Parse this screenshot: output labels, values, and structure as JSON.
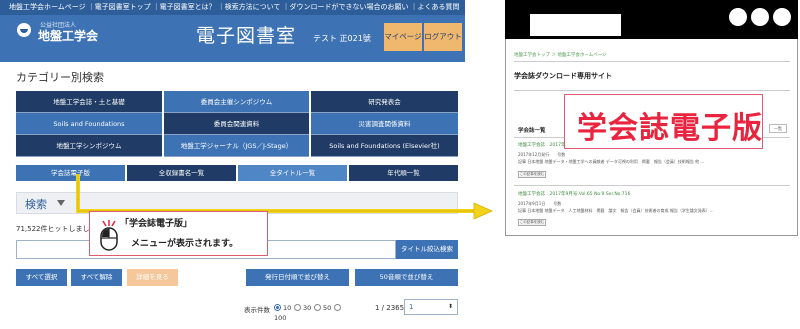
{
  "topbar": {
    "links": [
      "地盤工学会ホームページ",
      "｜電子図書室トップ",
      "｜電子図書室とは？",
      "｜検索方法について",
      "｜ダウンロードができない場合のお願い",
      "｜よくある質問"
    ]
  },
  "header": {
    "logo_sub": "公益社団法人",
    "logo_main": "地盤工学会",
    "title": "電子図書室",
    "user": "テスト 正021號",
    "mypage_label": "マイページ",
    "logout_label": "ログアウト"
  },
  "category": {
    "title": "カテゴリー別検索",
    "items": [
      "地盤工学会誌・土と基礎",
      "委員会主催シンポジウム",
      "研究発表会",
      "Soils and Foundations",
      "委員会関連資料",
      "災害調査関係資料",
      "地盤工学シンポジウム",
      "地盤工学ジャーナル（JGS／J-Stage）",
      "Soils and Foundations (Elsevier社)"
    ]
  },
  "tabs": [
    "学会誌電子版",
    "全収録書名一覧",
    "全タイトル一覧",
    "年代順一覧"
  ],
  "search": {
    "label": "検索",
    "hits": "71,522件ヒットしました",
    "refine_button": "タイトル絞込検索"
  },
  "actions": {
    "select_all": "すべて選択",
    "deselect_all": "すべて解除",
    "details": "詳細を見る",
    "sort_date": "発行日付順で並び替え",
    "sort_kana": "50音順で並び替え"
  },
  "paging": {
    "per_page_label": "表示件数",
    "options": [
      "10",
      "30",
      "50",
      "100"
    ],
    "selected": "10",
    "page_of": "1 / 2365",
    "current_page": "1"
  },
  "callout": {
    "line1": "「学会誌電子版」",
    "line2": "メニューが表示されます。"
  },
  "right_site": {
    "crumb": "地盤工学会トップ ＞ 地盤工学会ホームページ",
    "heading": "学会誌ダウンロード専用サイト",
    "list_head": "学会誌一覧",
    "list_tag": "一覧",
    "rows": [
      {
        "title": "地盤工学会誌　2017年",
        "meta1": "2017年12月発行　　号数",
        "meta2": "記事 日本地盤 地盤データ・地盤工学への貢献者 データ可視の利用　掲載　報告（会員）技術報告 他 …",
        "btn": "この記事を読む"
      },
      {
        "title": "地盤工学会誌　2017年9月号 Vol.65 No.9 Ser.No.716",
        "meta1": "2017年9月1日　　号数",
        "meta2": "記事 日本地盤 地盤データ　人工地盤材料　掲載　論文　報告（会員）技術者の育成 報告（学生論文発表）…",
        "btn": "この記事を読む"
      }
    ],
    "big_label": "学会誌電子版"
  },
  "colors": {
    "brand_blue": "#3d73b5",
    "navy": "#1f3b66",
    "accent_orange": "#f0b86e",
    "callout_red": "#e8243f",
    "arrow_yellow": "#f2d21a"
  }
}
